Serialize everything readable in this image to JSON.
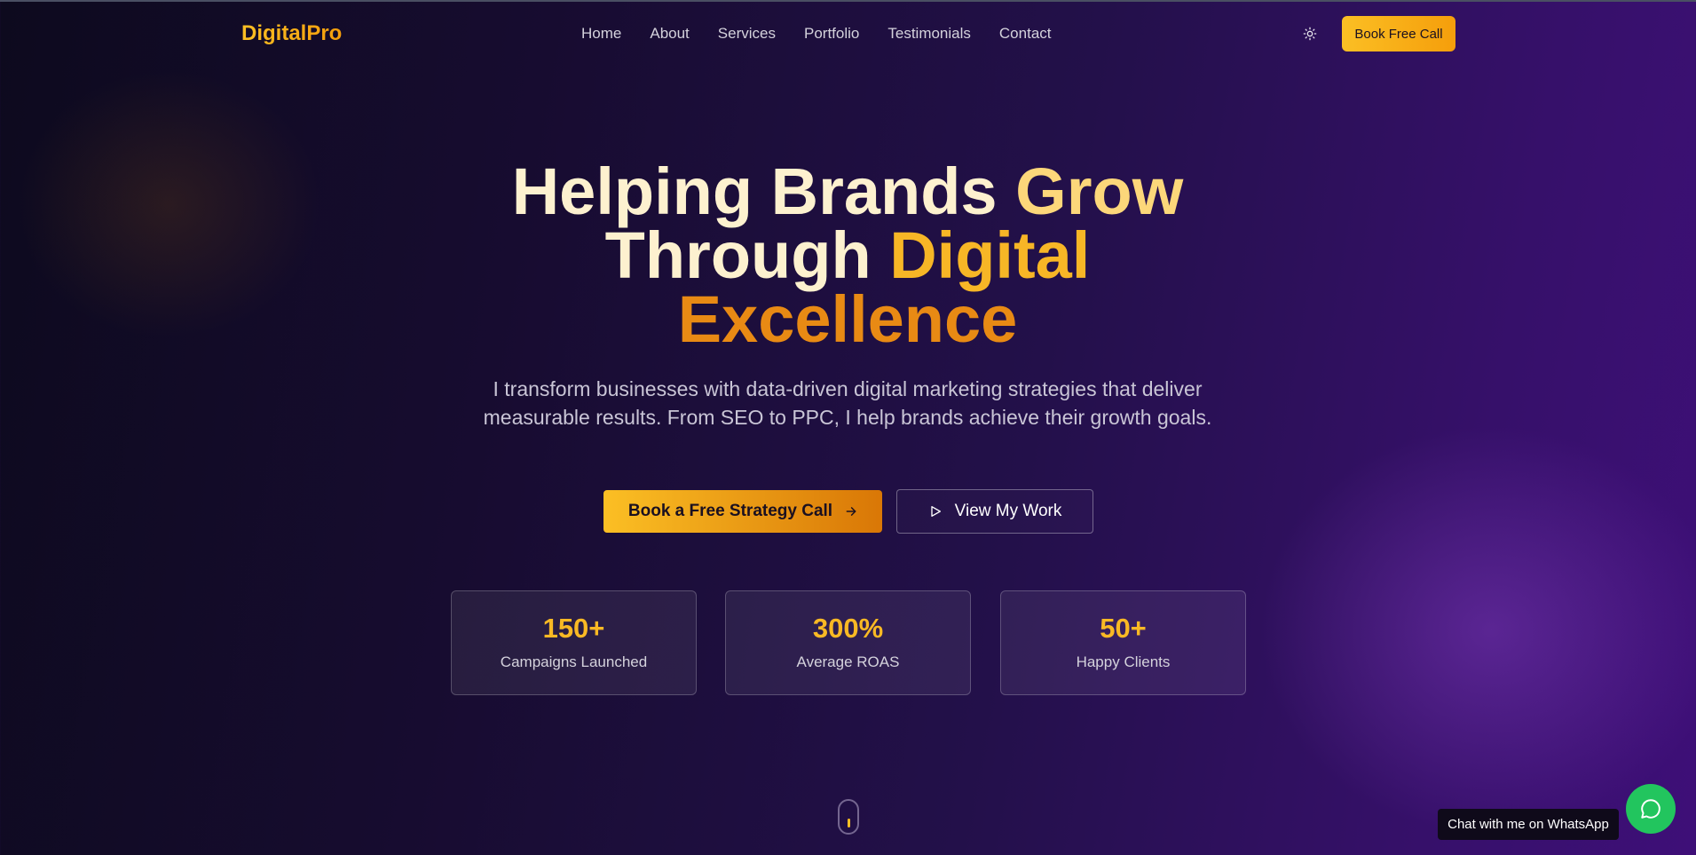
{
  "brand": {
    "logo": "DigitalPro"
  },
  "nav": {
    "items": [
      "Home",
      "About",
      "Services",
      "Portfolio",
      "Testimonials",
      "Contact"
    ],
    "cta_label": "Book Free Call",
    "theme_icon": "sun-icon"
  },
  "hero": {
    "headline": {
      "line1_a": "Helping",
      "line1_b": "Brands",
      "line1_c": "Grow",
      "line2_a": "Through",
      "line2_b": "Digital",
      "line3": "Excellence"
    },
    "subtitle": "I transform businesses with data-driven digital marketing strategies that deliver measurable results. From SEO to PPC, I help brands achieve their growth goals.",
    "primary_cta": "Book a Free Strategy Call",
    "secondary_cta": "View My Work"
  },
  "stats": [
    {
      "value": "150+",
      "label": "Campaigns Launched"
    },
    {
      "value": "300%",
      "label": "Average ROAS"
    },
    {
      "value": "50+",
      "label": "Happy Clients"
    }
  ],
  "whatsapp": {
    "tooltip": "Chat with me on WhatsApp",
    "icon": "whatsapp-chat-icon"
  },
  "colors": {
    "accent": "#fbbf24",
    "accent_dark": "#d97706",
    "whatsapp": "#22c55e",
    "background_start": "#0d0a1e",
    "background_end": "#3e0f78"
  }
}
